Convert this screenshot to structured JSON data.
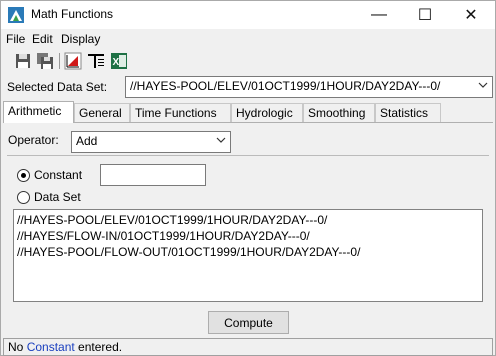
{
  "window": {
    "title": "Math Functions",
    "controls": {
      "minimize": "—",
      "maximize": "☐",
      "close": "✕"
    }
  },
  "menu": [
    "File",
    "Edit",
    "Display"
  ],
  "toolbar": {
    "icons": [
      "save-icon",
      "save-all-icon",
      "plot-icon",
      "table-icon",
      "excel-icon"
    ]
  },
  "dataset": {
    "label": "Selected Data Set:",
    "value": "//HAYES-POOL/ELEV/01OCT1999/1HOUR/DAY2DAY---0/"
  },
  "tabs": [
    "Arithmetic",
    "General",
    "Time Functions",
    "Hydrologic",
    "Smoothing",
    "Statistics"
  ],
  "active_tab": "Arithmetic",
  "operator": {
    "label": "Operator:",
    "value": "Add"
  },
  "constant": {
    "label": "Constant",
    "selected": true,
    "value": ""
  },
  "dataset_option": {
    "label": "Data Set",
    "selected": false
  },
  "datasets": [
    "//HAYES-POOL/ELEV/01OCT1999/1HOUR/DAY2DAY---0/",
    "//HAYES/FLOW-IN/01OCT1999/1HOUR/DAY2DAY---0/",
    "//HAYES-POOL/FLOW-OUT/01OCT1999/1HOUR/DAY2DAY---0/"
  ],
  "compute_label": "Compute",
  "status": {
    "prefix": "No ",
    "highlight": "Constant",
    "suffix": " entered."
  },
  "colors": {
    "status_highlight": "#1a3fbf",
    "excel_green": "#1e7145"
  }
}
